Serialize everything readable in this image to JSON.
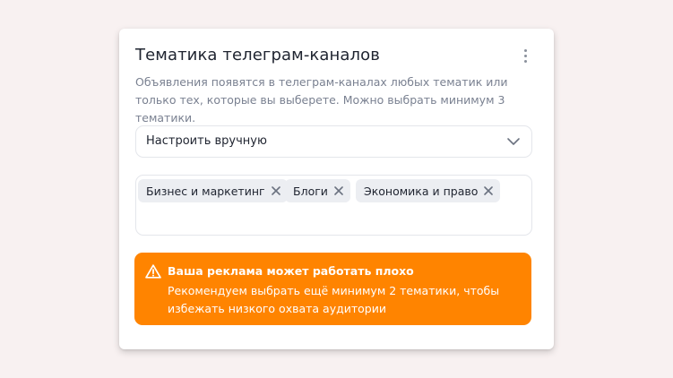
{
  "card": {
    "title": "Тематика телеграм-каналов",
    "menu_icon": "kebab-menu-icon",
    "description": "Объявления появятся в телеграм-каналах любых тематик или только тех, которые вы выберете. Можно выбрать минимум 3 тематики."
  },
  "mode_select": {
    "selected": "Настроить вручную",
    "icon": "chevron-down-icon"
  },
  "tags": [
    {
      "label": "Бизнес и маркетинг",
      "remove_icon": "close-icon"
    },
    {
      "label": "Блоги",
      "remove_icon": "close-icon"
    },
    {
      "label": "Экономика и право",
      "remove_icon": "close-icon"
    }
  ],
  "alert": {
    "icon": "warning-icon",
    "title": "Ваша реклама может работать плохо",
    "text": "Рекомендуем выбрать ещё минимум 2 тематики, чтобы избежать низкого охвата аудитории"
  },
  "colors": {
    "alert_background": "#ff8400",
    "page_background": "#f8f1f1",
    "tag_background": "#eceef2"
  }
}
